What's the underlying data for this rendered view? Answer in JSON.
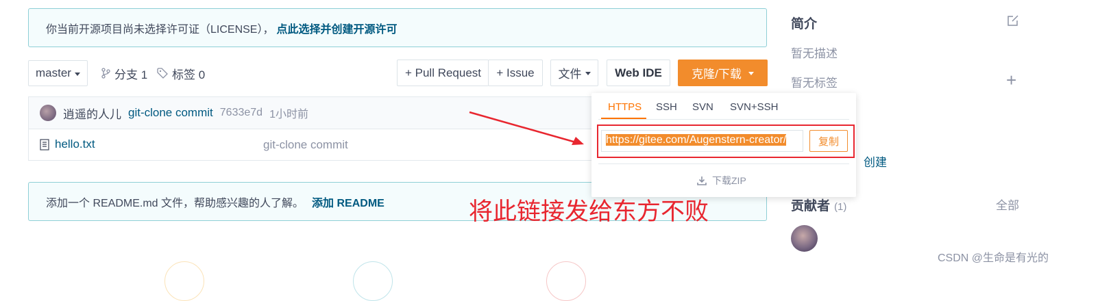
{
  "license_notice": {
    "text": "你当前开源项目尚未选择许可证（LICENSE），",
    "action": "点此选择并创建开源许可"
  },
  "toolbar": {
    "branch": "master",
    "branches_label": "分支 1",
    "tags_label": "标签 0",
    "pull_request": "+ Pull Request",
    "issue": "+ Issue",
    "file": "文件",
    "web_ide": "Web IDE",
    "clone_download": "克隆/下载"
  },
  "commit_bar": {
    "author": "逍遥的人儿",
    "message": "git-clone commit",
    "hash": "7633e7d",
    "time": "1小时前"
  },
  "files": [
    {
      "name": "hello.txt",
      "commit": "git-clone commit"
    }
  ],
  "readme_notice": {
    "text": "添加一个 README.md 文件，帮助感兴趣的人了解。",
    "action": "添加 README"
  },
  "clone_dropdown": {
    "tabs": [
      "HTTPS",
      "SSH",
      "SVN",
      "SVN+SSH"
    ],
    "active_tab": "HTTPS",
    "url": "https://gitee.com/Augenstern-creator/",
    "copy": "复制",
    "download_zip": "下载ZIP"
  },
  "sidebar": {
    "intro_title": "简介",
    "no_description": "暂无描述",
    "no_tags": "暂无标签",
    "partial_link": "创建",
    "contributors_title": "贡献者",
    "contributors_count": "(1)",
    "all_link": "全部"
  },
  "annotation": "将此链接发给东方不败",
  "watermark": "CSDN @生命是有光的",
  "colors": {
    "accent_orange": "#f28c2c",
    "link_blue": "#005980",
    "annotation_red": "#e8262f",
    "notice_border": "#8ecfd6"
  }
}
